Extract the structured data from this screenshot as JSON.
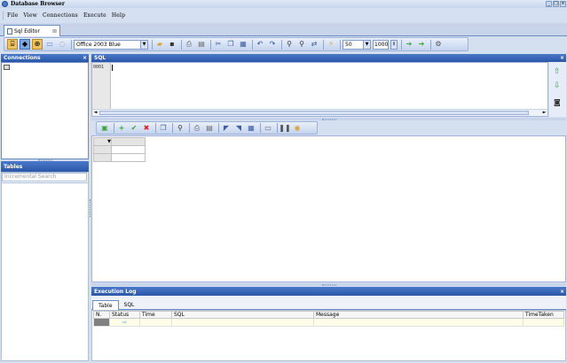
{
  "window": {
    "title": "Database Browser",
    "controls": [
      "_",
      "□",
      "×"
    ]
  },
  "menu": [
    "File",
    "View",
    "Connections",
    "Execute",
    "Help"
  ],
  "document_tab": {
    "label": "Sql Editor",
    "close": "⊠"
  },
  "toolbar": {
    "theme_select": "Office 2003 Blue",
    "fetch_size_select": "50",
    "limit_value": "1000"
  },
  "connections_panel": {
    "title": "Connections",
    "close": "×"
  },
  "tables_panel": {
    "title": "Tables",
    "search_placeholder": "Incremental Search"
  },
  "sql_panel": {
    "title": "SQL",
    "close": "×",
    "line_number": "0001"
  },
  "execution_log": {
    "title": "Execution Log",
    "close": "×",
    "tabs": [
      "Table",
      "SQL"
    ],
    "columns": [
      "N.",
      "Status",
      "Time",
      "SQL",
      "Message",
      "TimeTaken"
    ]
  },
  "colors": {
    "panel_header": "#2a56a8",
    "accent_orange": "#f0c260",
    "green_arrow": "#3aa33a"
  }
}
